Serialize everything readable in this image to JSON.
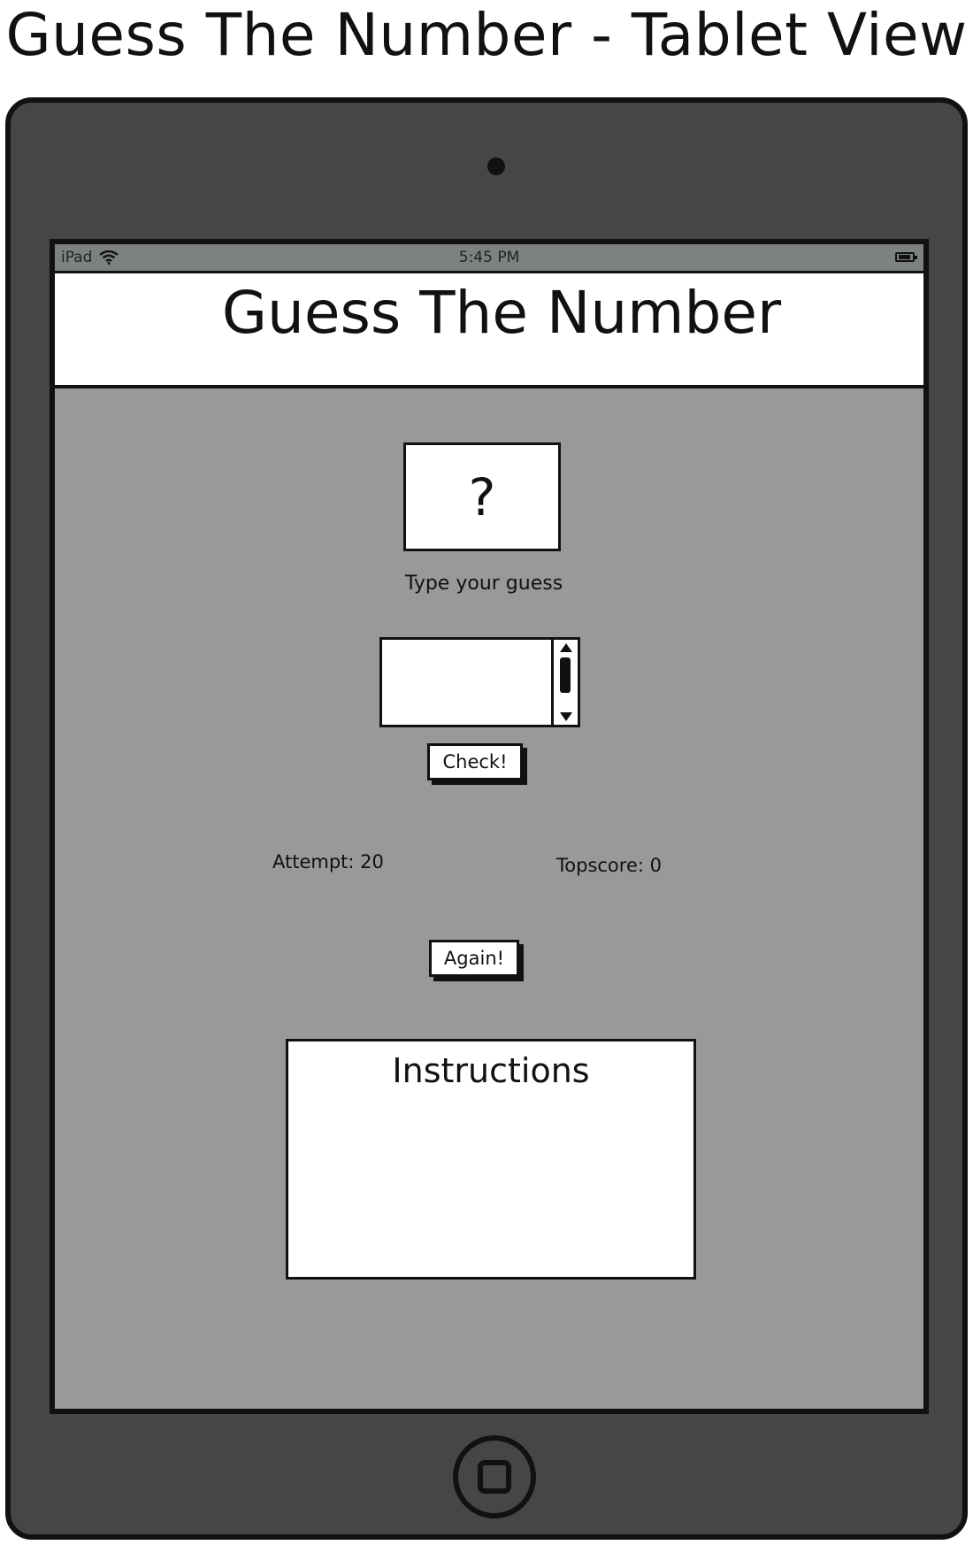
{
  "page": {
    "heading": "Guess The Number - Tablet View"
  },
  "status_bar": {
    "carrier": "iPad",
    "time": "5:45 PM",
    "icons": [
      "wifi-icon",
      "battery-icon"
    ]
  },
  "app": {
    "title": "Guess The Number",
    "mystery_symbol": "?",
    "guess_label": "Type your guess",
    "guess_input": {
      "value": "",
      "placeholder": ""
    },
    "check_button_label": "Check!",
    "attempt_text": "Attempt: 20",
    "topscore_text": "Topscore: 0",
    "again_button_label": "Again!",
    "instructions_title": "Instructions"
  },
  "colors": {
    "device_body": "#464646",
    "screen_background": "#999999",
    "status_bar": "#7d8182",
    "panel": "#ffffff",
    "outline": "#111111"
  }
}
